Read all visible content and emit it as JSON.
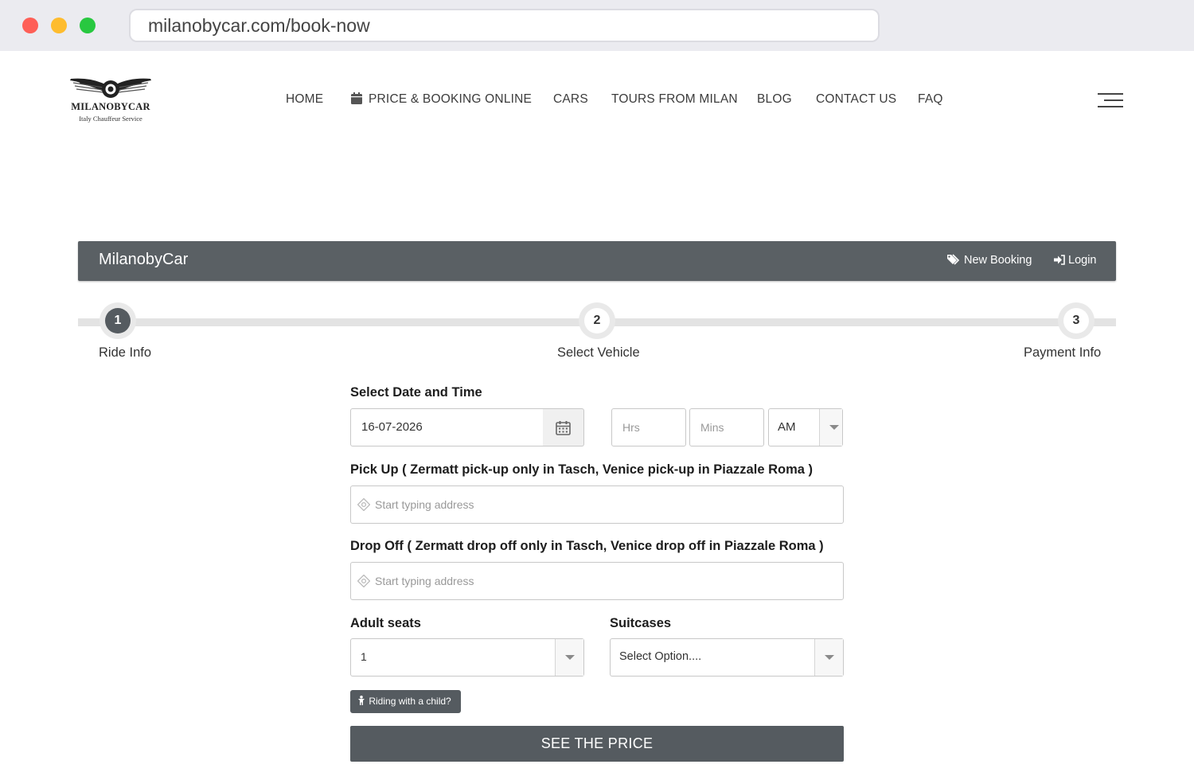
{
  "browser": {
    "url": "milanobycar.com/book-now"
  },
  "logo": {
    "name": "MILANOBYCAR",
    "tagline": "Italy Chauffeur Service"
  },
  "nav": {
    "items": [
      "HOME",
      "PRICE & BOOKING ONLINE",
      "CARS",
      "TOURS FROM MILAN",
      "BLOG",
      "CONTACT US",
      "FAQ"
    ]
  },
  "booking_bar": {
    "title": "MilanobyCar",
    "new_booking": "New Booking",
    "login": "Login"
  },
  "steps": [
    {
      "number": "1",
      "label": "Ride Info",
      "active": true
    },
    {
      "number": "2",
      "label": "Select Vehicle",
      "active": false
    },
    {
      "number": "3",
      "label": "Payment Info",
      "active": false
    }
  ],
  "form": {
    "datetime_label": "Select Date and Time",
    "date_value": "16-07-2026",
    "hours_placeholder": "Hrs",
    "minutes_placeholder": "Mins",
    "ampm_value": "AM",
    "pickup_label": "Pick Up ( Zermatt pick-up only in Tasch, Venice pick-up in Piazzale Roma )",
    "pickup_placeholder": "Start typing address",
    "dropoff_label": "Drop Off ( Zermatt drop off only in Tasch, Venice drop off in Piazzale Roma )",
    "dropoff_placeholder": "Start typing address",
    "adult_seats_label": "Adult seats",
    "adult_seats_value": "1",
    "suitcases_label": "Suitcases",
    "suitcases_value": "Select Option....",
    "child_button": "Riding with a child?",
    "submit_button": "SEE THE PRICE"
  },
  "colors": {
    "primary_dark": "#555b60",
    "browser_chrome": "#ebebf0"
  }
}
